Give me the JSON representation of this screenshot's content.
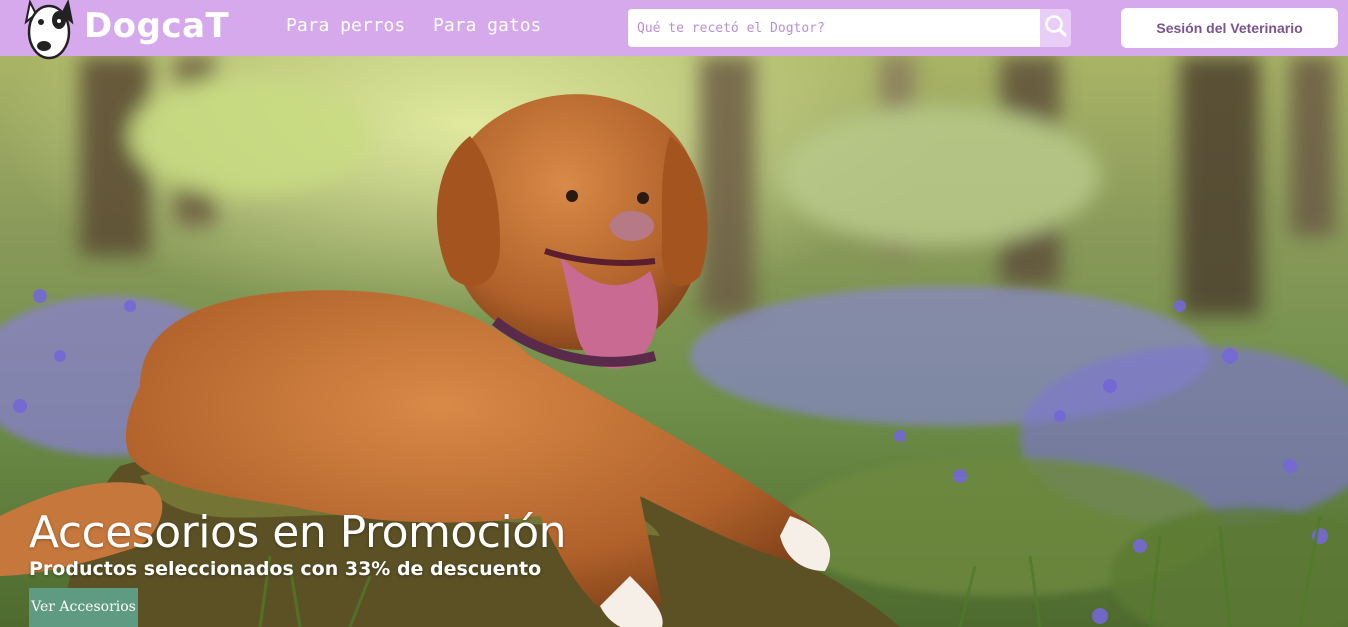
{
  "brand": {
    "name": "DogcaT",
    "logo_icon": "bull-terrier-dog-icon"
  },
  "nav": {
    "links": [
      {
        "label": "Para perros"
      },
      {
        "label": "Para gatos"
      }
    ]
  },
  "search": {
    "placeholder": "Qué te recetó el Dogtor?",
    "value": "",
    "icon": "search-icon"
  },
  "session_button": {
    "label": "Sesión del Veterinario"
  },
  "hero": {
    "title": "Accesorios en Promoción",
    "subtitle": "Productos seleccionados con 33% de descuento",
    "cta_label": "Ver Accesorios",
    "image": "photo-dog-in-bluebell-forest"
  },
  "colors": {
    "navbar": "#d5a9ec",
    "session_text": "#7a5390",
    "cta": "#5f9a83",
    "search_button": "#e8cef6"
  }
}
